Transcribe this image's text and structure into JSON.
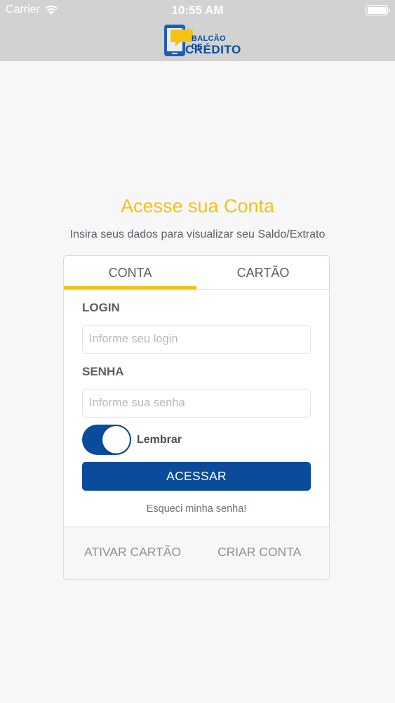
{
  "status_bar": {
    "carrier": "Carrier",
    "time": "10:55 AM"
  },
  "header": {
    "logo_line1": "BALCÃO DE",
    "logo_line2": "CRÉDITO"
  },
  "page": {
    "title": "Acesse sua Conta",
    "subtitle": "Insira seus dados para visualizar seu Saldo/Extrato"
  },
  "tabs": [
    {
      "label": "CONTA",
      "active": true
    },
    {
      "label": "CARTÃO",
      "active": false
    }
  ],
  "form": {
    "login_label": "LOGIN",
    "login_placeholder": "Informe seu login",
    "login_value": "",
    "password_label": "SENHA",
    "password_placeholder": "Informe sua senha",
    "password_value": "",
    "remember_label": "Lembrar",
    "remember_on": true,
    "submit_label": "ACESSAR",
    "forgot_label": "Esqueci minha senha!"
  },
  "footer": {
    "activate_card_label": "ATIVAR CARTÃO",
    "create_account_label": "CRIAR CONTA"
  },
  "colors": {
    "accent_yellow": "#f4c213",
    "primary_blue": "#0b4b9c",
    "header_gray": "#d2d2d2"
  }
}
